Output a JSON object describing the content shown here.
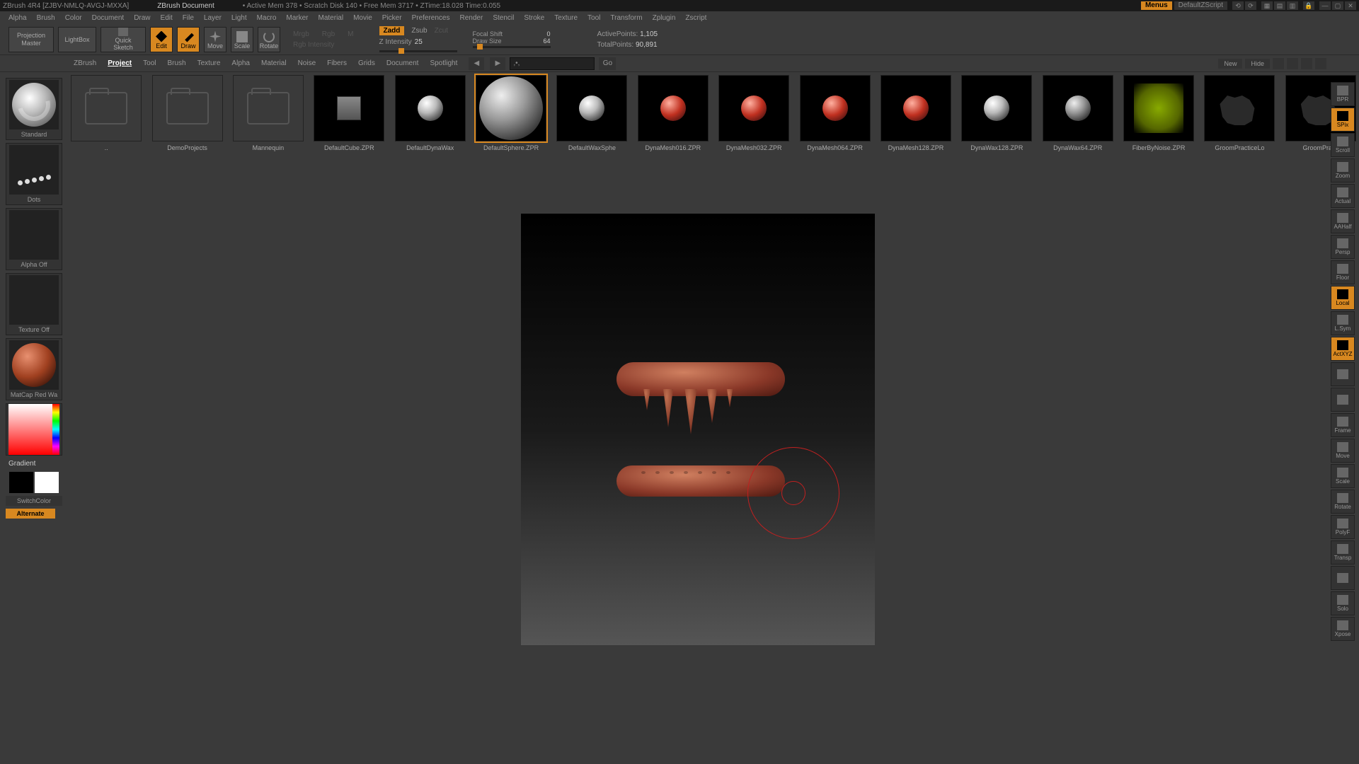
{
  "titlebar": {
    "app": "ZBrush 4R4 [ZJBV-NMLQ-AVGJ-MXXA]",
    "document": "ZBrush Document",
    "stats": "• Active Mem 378  • Scratch Disk 140  • Free Mem 3717  • ZTime:18.028  Time:0.055",
    "menus": "Menus",
    "default_zscript": "DefaultZScript"
  },
  "menubar": [
    "Alpha",
    "Brush",
    "Color",
    "Document",
    "Draw",
    "Edit",
    "File",
    "Layer",
    "Light",
    "Macro",
    "Marker",
    "Material",
    "Movie",
    "Picker",
    "Preferences",
    "Render",
    "Stencil",
    "Stroke",
    "Texture",
    "Tool",
    "Transform",
    "Zplugin",
    "Zscript"
  ],
  "toolbar": {
    "projection_master": "Projection\nMaster",
    "lightbox": "LightBox",
    "quick_sketch": "Quick\nSketch",
    "edit": "Edit",
    "draw": "Draw",
    "move": "Move",
    "scale": "Scale",
    "rotate": "Rotate",
    "mrgb": "Mrgb",
    "rgb": "Rgb",
    "m": "M",
    "rgb_intensity": "Rgb Intensity",
    "zadd": "Zadd",
    "zsub": "Zsub",
    "zcut": "Zcut",
    "z_intensity_label": "Z Intensity",
    "z_intensity_val": "25",
    "focal_shift_label": "Focal Shift",
    "focal_shift_val": "0",
    "draw_size_label": "Draw Size",
    "draw_size_val": "64",
    "active_points_label": "ActivePoints:",
    "active_points_val": "1,105",
    "total_points_label": "TotalPoints:",
    "total_points_val": "90,891"
  },
  "secbar": {
    "tabs": [
      "ZBrush",
      "Project",
      "Tool",
      "Brush",
      "Texture",
      "Alpha",
      "Material",
      "Noise",
      "Fibers",
      "Grids",
      "Document",
      "Spotlight"
    ],
    "active_tab": 1,
    "path": ",•,",
    "go": "Go",
    "new": "New",
    "hide": "Hide"
  },
  "lightbox_items": [
    {
      "label": "..",
      "kind": "folder"
    },
    {
      "label": "DemoProjects",
      "kind": "folder"
    },
    {
      "label": "Mannequin",
      "kind": "folder"
    },
    {
      "label": "DefaultCube.ZPR",
      "kind": "cube"
    },
    {
      "label": "DefaultDynaWax",
      "kind": "sphere-white"
    },
    {
      "label": "DefaultSphere.ZPR",
      "kind": "sphere-big",
      "selected": true
    },
    {
      "label": "DefaultWaxSphe",
      "kind": "sphere-white"
    },
    {
      "label": "DynaMesh016.ZPR",
      "kind": "sphere-red"
    },
    {
      "label": "DynaMesh032.ZPR",
      "kind": "sphere-red"
    },
    {
      "label": "DynaMesh064.ZPR",
      "kind": "sphere-red"
    },
    {
      "label": "DynaMesh128.ZPR",
      "kind": "sphere-red"
    },
    {
      "label": "DynaWax128.ZPR",
      "kind": "sphere-white"
    },
    {
      "label": "DynaWax64.ZPR",
      "kind": "sphere-grey"
    },
    {
      "label": "FiberByNoise.ZPR",
      "kind": "fiber"
    },
    {
      "label": "GroomPracticeLo",
      "kind": "dog"
    },
    {
      "label": "GroomPracti",
      "kind": "dog"
    }
  ],
  "left_sidebar": {
    "brush_label": "Standard",
    "stroke_label": "Dots",
    "alpha_label": "Alpha Off",
    "texture_label": "Texture Off",
    "material_label": "MatCap Red Wa",
    "gradient": "Gradient",
    "switch_color": "SwitchColor",
    "alternate": "Alternate"
  },
  "right_sidebar": [
    {
      "label": "BPR",
      "active": false
    },
    {
      "label": "SPix",
      "active": true
    },
    {
      "label": "Scroll",
      "active": false
    },
    {
      "label": "Zoom",
      "active": false
    },
    {
      "label": "Actual",
      "active": false
    },
    {
      "label": "AAHalf",
      "active": false
    },
    {
      "label": "Persp",
      "active": false
    },
    {
      "label": "Floor",
      "active": false
    },
    {
      "label": "Local",
      "active": true
    },
    {
      "label": "L.Sym",
      "active": false
    },
    {
      "label": "ActXYZ",
      "active": true
    },
    {
      "label": "",
      "active": false
    },
    {
      "label": "",
      "active": false
    },
    {
      "label": "Frame",
      "active": false
    },
    {
      "label": "Move",
      "active": false
    },
    {
      "label": "Scale",
      "active": false
    },
    {
      "label": "Rotate",
      "active": false
    },
    {
      "label": "PolyF",
      "active": false
    },
    {
      "label": "Transp",
      "active": false
    },
    {
      "label": "",
      "active": false
    },
    {
      "label": "Solo",
      "active": false
    },
    {
      "label": "Xpose",
      "active": false
    }
  ]
}
